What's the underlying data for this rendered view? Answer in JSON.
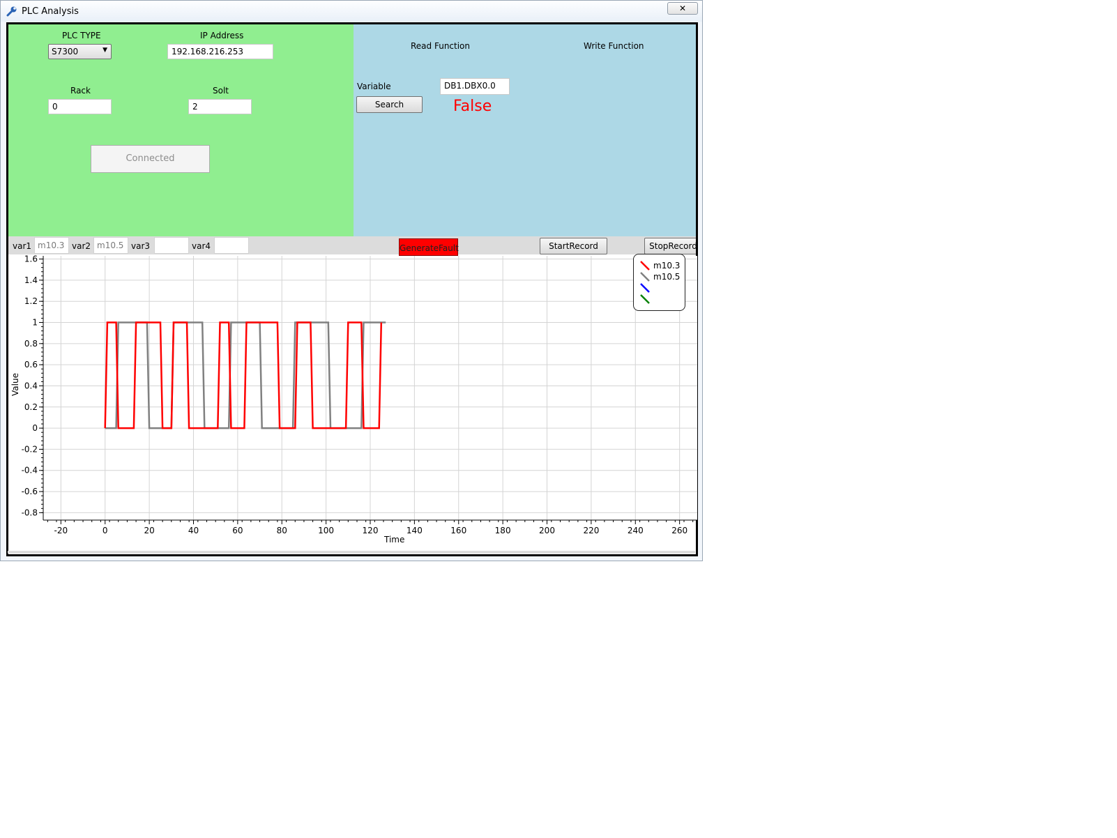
{
  "window": {
    "title": "PLC Analysis",
    "close_glyph": "✕",
    "icon": "wrench-icon"
  },
  "connection": {
    "plc_type_label": "PLC TYPE",
    "plc_type_value": "S7300",
    "ip_label": "IP Address",
    "ip_value": "192.168.216.253",
    "rack_label": "Rack",
    "rack_value": "0",
    "slot_label": "Solt",
    "slot_value": "2",
    "connect_button": "Connected"
  },
  "read_write": {
    "read_title": "Read Function",
    "write_title": "Write Function",
    "variable_label": "Variable",
    "variable_value": "DB1.DBX0.0",
    "search_button": "Search",
    "result": "False",
    "result_color": "#ff0000"
  },
  "variables": {
    "items": [
      {
        "label": "var1",
        "value": "m10.3"
      },
      {
        "label": "var2",
        "value": "m10.5"
      },
      {
        "label": "var3",
        "value": ""
      },
      {
        "label": "var4",
        "value": ""
      }
    ],
    "generate_fault": "GenerateFault",
    "start_record": "StartRecord",
    "stop_record": "StopRecord"
  },
  "colors": {
    "left_panel": "#90ee90",
    "right_panel": "#add8e6",
    "fault": "#ff0000"
  },
  "chart_data": {
    "type": "line",
    "xlabel": "Time",
    "ylabel": "Value",
    "xlim": [
      -28,
      268
    ],
    "ylim": [
      -0.87,
      1.63
    ],
    "xticks": [
      -20,
      0,
      20,
      40,
      60,
      80,
      100,
      120,
      140,
      160,
      180,
      200,
      220,
      240,
      260
    ],
    "yticks": [
      -0.8,
      -0.6,
      -0.4,
      -0.2,
      0,
      0.2,
      0.4,
      0.6,
      0.8,
      1,
      1.2,
      1.4,
      1.6
    ],
    "grid": true,
    "legend_position": "top-right",
    "series": [
      {
        "name": "m10.3",
        "color": "#ff0000",
        "x": [
          0,
          1,
          5,
          6,
          13,
          14,
          25,
          26,
          30,
          31,
          37,
          38,
          51,
          52,
          56,
          57,
          63,
          64,
          78,
          79,
          86,
          87,
          93,
          94,
          109,
          110,
          116,
          117,
          124,
          125
        ],
        "y": [
          0,
          1,
          1,
          0,
          0,
          1,
          1,
          0,
          0,
          1,
          1,
          0,
          0,
          1,
          1,
          0,
          0,
          1,
          1,
          0,
          0,
          1,
          1,
          0,
          0,
          1,
          1,
          0,
          0,
          1
        ]
      },
      {
        "name": "m10.5",
        "color": "#808080",
        "x": [
          0,
          5,
          6,
          19,
          20,
          30,
          31,
          44,
          45,
          56,
          57,
          70,
          71,
          85,
          86,
          101,
          102,
          116,
          117,
          127
        ],
        "y": [
          0,
          0,
          1,
          1,
          0,
          0,
          1,
          1,
          0,
          0,
          1,
          1,
          0,
          0,
          1,
          1,
          0,
          0,
          1,
          1
        ]
      },
      {
        "color": "#0000ff",
        "x": [],
        "y": []
      },
      {
        "color": "#008000",
        "x": [],
        "y": []
      }
    ]
  }
}
